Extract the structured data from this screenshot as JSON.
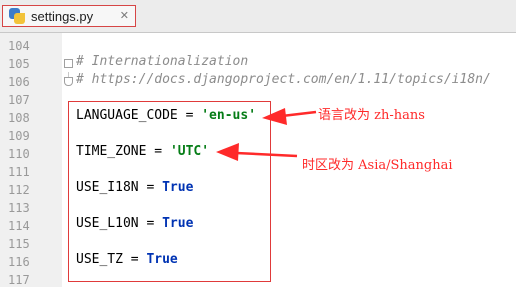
{
  "tab": {
    "file_name": "settings.py",
    "close_glyph": "✕",
    "icon": "python-file-icon"
  },
  "editor": {
    "line_numbers": [
      "104",
      "105",
      "106",
      "107",
      "108",
      "109",
      "110",
      "111",
      "112",
      "113",
      "114",
      "115",
      "116",
      "117"
    ],
    "comment1": "# Internationalization",
    "comment2": "# https://docs.djangoproject.com/en/1.11/topics/i18n/",
    "lang_name": "LANGUAGE_CODE",
    "lang_val": "'en-us'",
    "tz_name": "TIME_ZONE",
    "tz_val": "'UTC'",
    "i18n_name": "USE_I18N",
    "l10n_name": "USE_L10N",
    "tz_use_name": "USE_TZ",
    "true_kw": "True",
    "assign": "="
  },
  "annotations": {
    "lang_note": "语言改为 zh-hans",
    "tz_note": "时区改为 Asia/Shanghai",
    "color": "#ff2a2a"
  },
  "colors": {
    "string": "#067d17",
    "keyword": "#0033b3",
    "comment": "#8c8c8c",
    "highlight_box": "#e03a3a"
  }
}
